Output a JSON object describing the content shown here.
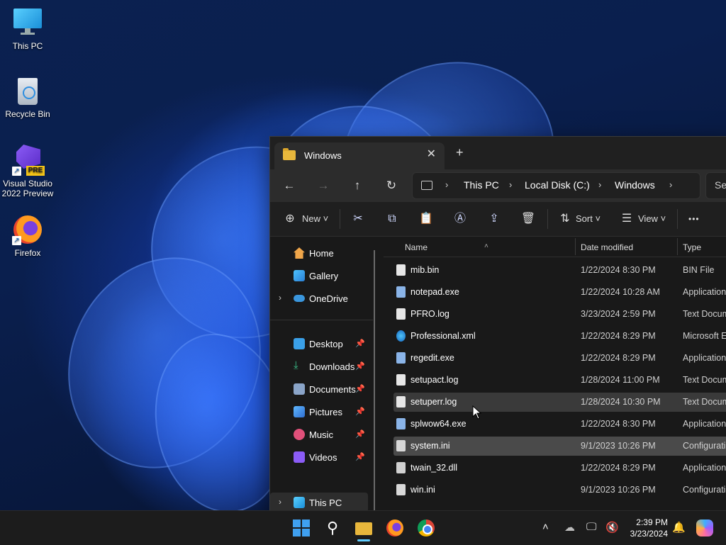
{
  "desktop": {
    "icons": [
      {
        "label": "This PC"
      },
      {
        "label": "Recycle Bin"
      },
      {
        "label": "Visual Studio 2022 Preview",
        "badge": "PRE"
      },
      {
        "label": "Firefox"
      }
    ]
  },
  "window": {
    "tab_title": "Windows",
    "tab_close": "✕",
    "new_tab": "+",
    "breadcrumb": [
      "This PC",
      "Local Disk (C:)",
      "Windows"
    ],
    "breadcrumb_sep": "›",
    "search_placeholder": "Se",
    "toolbar": {
      "new_label": "New",
      "sort_label": "Sort",
      "view_label": "View",
      "more_label": "•••"
    },
    "nav": {
      "items": [
        {
          "label": "Home"
        },
        {
          "label": "Gallery"
        },
        {
          "label": "OneDrive"
        },
        {
          "label": "Desktop"
        },
        {
          "label": "Downloads"
        },
        {
          "label": "Documents"
        },
        {
          "label": "Pictures"
        },
        {
          "label": "Music"
        },
        {
          "label": "Videos"
        },
        {
          "label": "This PC"
        }
      ]
    },
    "columns": {
      "name": "Name",
      "date": "Date modified",
      "type": "Type"
    },
    "files": [
      {
        "name": "mib.bin",
        "date": "1/22/2024 8:30 PM",
        "type": "BIN File"
      },
      {
        "name": "notepad.exe",
        "date": "1/22/2024 10:28 AM",
        "type": "Application"
      },
      {
        "name": "PFRO.log",
        "date": "3/23/2024 2:59 PM",
        "type": "Text Docum"
      },
      {
        "name": "Professional.xml",
        "date": "1/22/2024 8:29 PM",
        "type": "Microsoft E"
      },
      {
        "name": "regedit.exe",
        "date": "1/22/2024 8:29 PM",
        "type": "Application"
      },
      {
        "name": "setupact.log",
        "date": "1/28/2024 11:00 PM",
        "type": "Text Docum"
      },
      {
        "name": "setuperr.log",
        "date": "1/28/2024 10:30 PM",
        "type": "Text Docum"
      },
      {
        "name": "splwow64.exe",
        "date": "1/22/2024 8:30 PM",
        "type": "Application"
      },
      {
        "name": "system.ini",
        "date": "9/1/2023 10:26 PM",
        "type": "Configuratio"
      },
      {
        "name": "twain_32.dll",
        "date": "1/22/2024 8:29 PM",
        "type": "Application"
      },
      {
        "name": "win.ini",
        "date": "9/1/2023 10:26 PM",
        "type": "Configuratio"
      }
    ]
  },
  "taskbar": {
    "time": "2:39 PM",
    "date": "3/23/2024"
  },
  "colors": {
    "accent": "#0067c0",
    "folder": "#e8b73c",
    "window_bg": "#191919",
    "taskbar_bg": "#1c1c1c"
  }
}
